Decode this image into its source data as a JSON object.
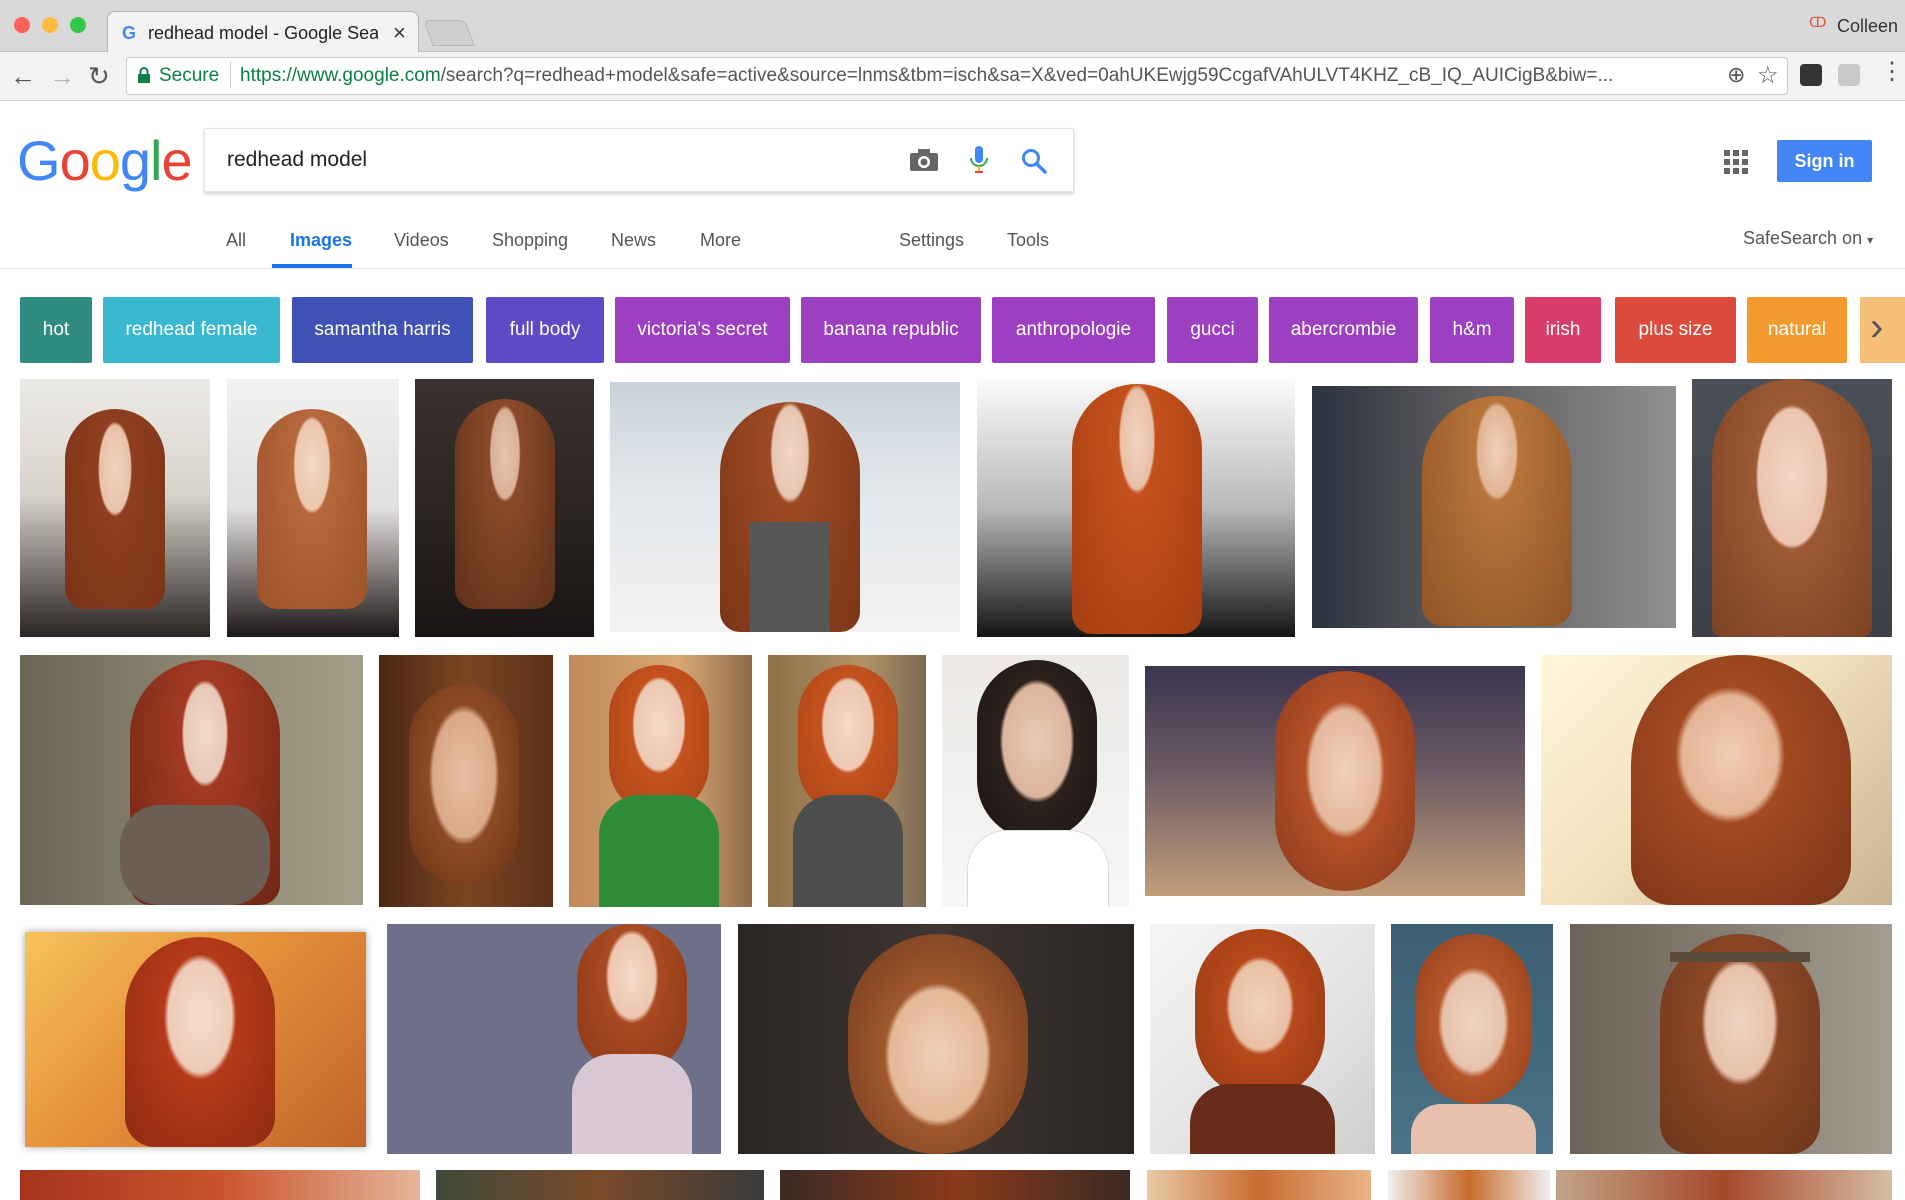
{
  "browser": {
    "tab_title": "redhead model - Google Search",
    "tab_close": "×",
    "profile_name": "Colleen",
    "secure_label": "Secure",
    "url_host": "https://www.google.com",
    "url_path": "/search?q=redhead+model&safe=active&source=lnms&tbm=isch&sa=X&ved=0ahUKEwjg59CcgafVAhULVT4KHZ_cB_IQ_AUICigB&biw=..."
  },
  "google": {
    "logo_letters": [
      "G",
      "o",
      "o",
      "g",
      "l",
      "e"
    ],
    "logo_colors": [
      "#4285f4",
      "#ea4335",
      "#fbbc05",
      "#4285f4",
      "#34a853",
      "#ea4335"
    ],
    "query": "redhead model",
    "sign_in": "Sign in",
    "nav": [
      {
        "label": "All",
        "active": false
      },
      {
        "label": "Images",
        "active": true
      },
      {
        "label": "Videos",
        "active": false
      },
      {
        "label": "Shopping",
        "active": false
      },
      {
        "label": "News",
        "active": false
      },
      {
        "label": "More",
        "active": false
      }
    ],
    "settings": "Settings",
    "tools": "Tools",
    "safesearch": "SafeSearch on"
  },
  "chips": [
    {
      "label": "hot",
      "color": "#2e8b80"
    },
    {
      "label": "redhead female",
      "color": "#3ab8cf"
    },
    {
      "label": "samantha harris",
      "color": "#3f51b5"
    },
    {
      "label": "full body",
      "color": "#5c4bc4"
    },
    {
      "label": "victoria's secret",
      "color": "#9c3fc0"
    },
    {
      "label": "banana republic",
      "color": "#9c3fc0"
    },
    {
      "label": "anthropologie",
      "color": "#9c3fc0"
    },
    {
      "label": "gucci",
      "color": "#9c3fc0"
    },
    {
      "label": "abercrombie",
      "color": "#9c3fc0"
    },
    {
      "label": "h&m",
      "color": "#9c3fc0"
    },
    {
      "label": "irish",
      "color": "#d83c6a"
    },
    {
      "label": "plus size",
      "color": "#dd4b3d"
    },
    {
      "label": "natural",
      "color": "#f29a2e"
    }
  ],
  "icons": [
    "camera-icon",
    "mic-icon",
    "search-icon",
    "apps-grid-icon",
    "lock-icon",
    "star-icon",
    "menu-dots-icon"
  ]
}
